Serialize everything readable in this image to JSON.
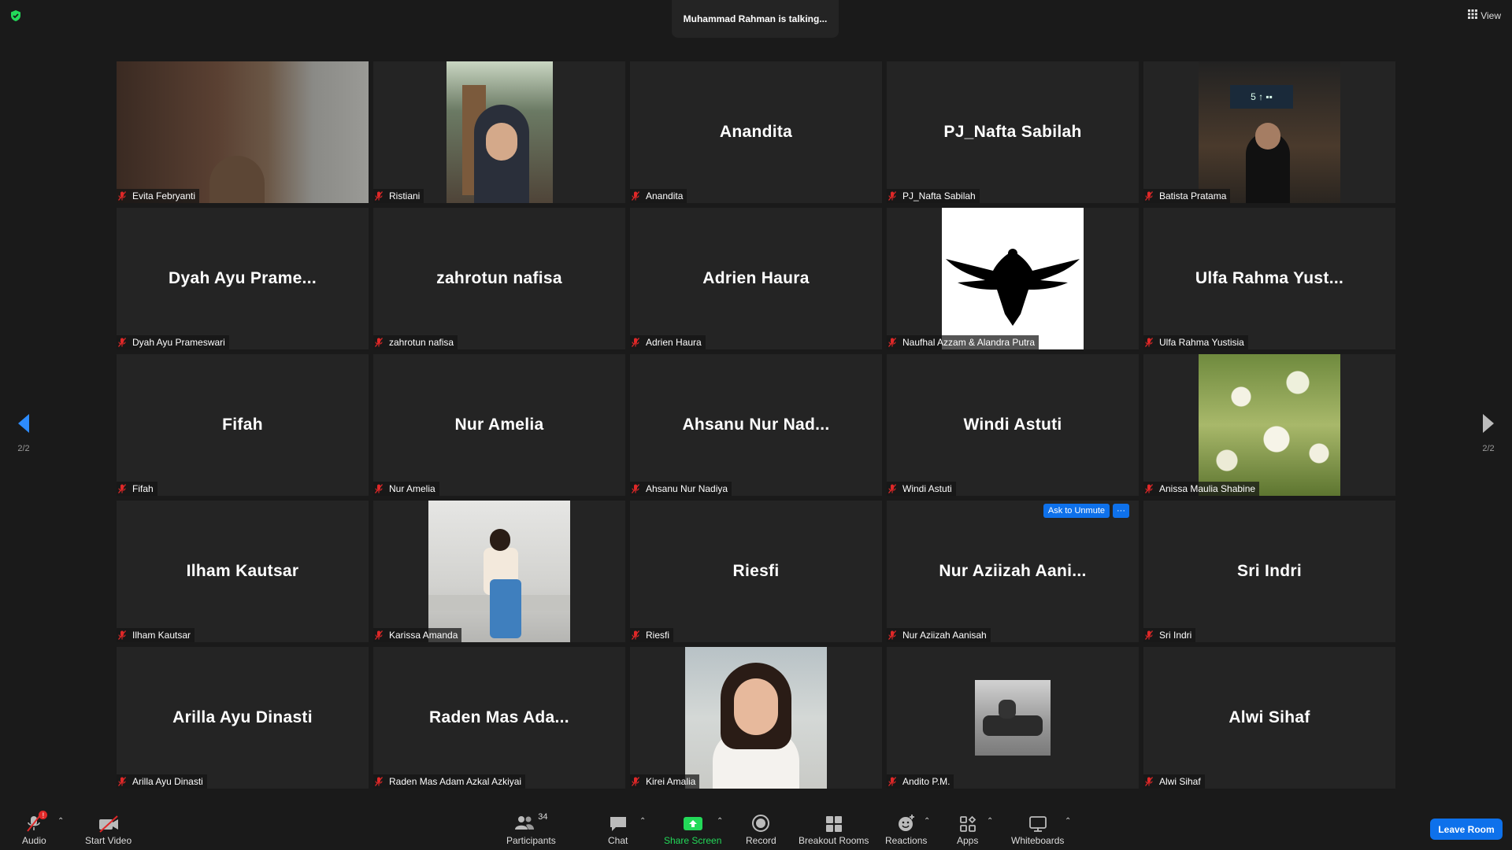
{
  "header": {
    "talking_text": "Muhammad Rahman is talking...",
    "view_label": "View"
  },
  "pagination": {
    "left": "2/2",
    "right": "2/2"
  },
  "tiles": [
    {
      "display": "",
      "name": "Evita Febryanti",
      "video": "evita"
    },
    {
      "display": "",
      "name": "Ristiani",
      "video": "ristiani"
    },
    {
      "display": "Anandita",
      "name": "Anandita"
    },
    {
      "display": "PJ_Nafta Sabilah",
      "name": "PJ_Nafta Sabilah"
    },
    {
      "display": "",
      "name": "Batista Pratama",
      "video": "batista"
    },
    {
      "display": "Dyah Ayu Prame...",
      "name": "Dyah Ayu Prameswari"
    },
    {
      "display": "zahrotun nafisa",
      "name": "zahrotun nafisa"
    },
    {
      "display": "Adrien Haura",
      "name": "Adrien Haura"
    },
    {
      "display": "",
      "name": "Naufhal Azzam & Alandra Putra",
      "video": "eagle"
    },
    {
      "display": "Ulfa Rahma Yust...",
      "name": "Ulfa Rahma Yustisia"
    },
    {
      "display": "Fifah",
      "name": "Fifah"
    },
    {
      "display": "Nur Amelia",
      "name": "Nur Amelia"
    },
    {
      "display": "Ahsanu Nur Nad...",
      "name": "Ahsanu Nur Nadiya"
    },
    {
      "display": "Windi Astuti",
      "name": "Windi Astuti"
    },
    {
      "display": "",
      "name": "Anissa Maulia Shabine",
      "video": "flowers"
    },
    {
      "display": "Ilham Kautsar",
      "name": "Ilham Kautsar"
    },
    {
      "display": "",
      "name": "Karissa Amanda",
      "video": "karissa"
    },
    {
      "display": "Riesfi",
      "name": "Riesfi"
    },
    {
      "display": "Nur Aziizah Aani...",
      "name": "Nur Aziizah Aanisah",
      "ask_unmute": "Ask to Unmute",
      "more": "···"
    },
    {
      "display": "Sri Indri",
      "name": "Sri Indri"
    },
    {
      "display": "Arilla Ayu Dinasti",
      "name": "Arilla Ayu Dinasti"
    },
    {
      "display": "Raden Mas Ada...",
      "name": "Raden Mas Adam Azkal Azkiyai"
    },
    {
      "display": "",
      "name": "Kirei Amalia",
      "video": "kirei"
    },
    {
      "display": "",
      "name": "Andito P.M.",
      "video": "car"
    },
    {
      "display": "Alwi Sihaf",
      "name": "Alwi Sihaf"
    }
  ],
  "toolbar": {
    "audio": "Audio",
    "audio_badge": "!",
    "start_video": "Start Video",
    "participants": "Participants",
    "participants_count": "34",
    "chat": "Chat",
    "share_screen": "Share Screen",
    "record": "Record",
    "breakout_rooms": "Breakout Rooms",
    "reactions": "Reactions",
    "apps": "Apps",
    "whiteboards": "Whiteboards",
    "leave": "Leave Room"
  },
  "colors": {
    "accent_blue": "#0e71eb",
    "share_green": "#23d959",
    "muted_red": "#e02828",
    "tile_bg": "#242424",
    "app_bg": "#1a1a1a"
  }
}
